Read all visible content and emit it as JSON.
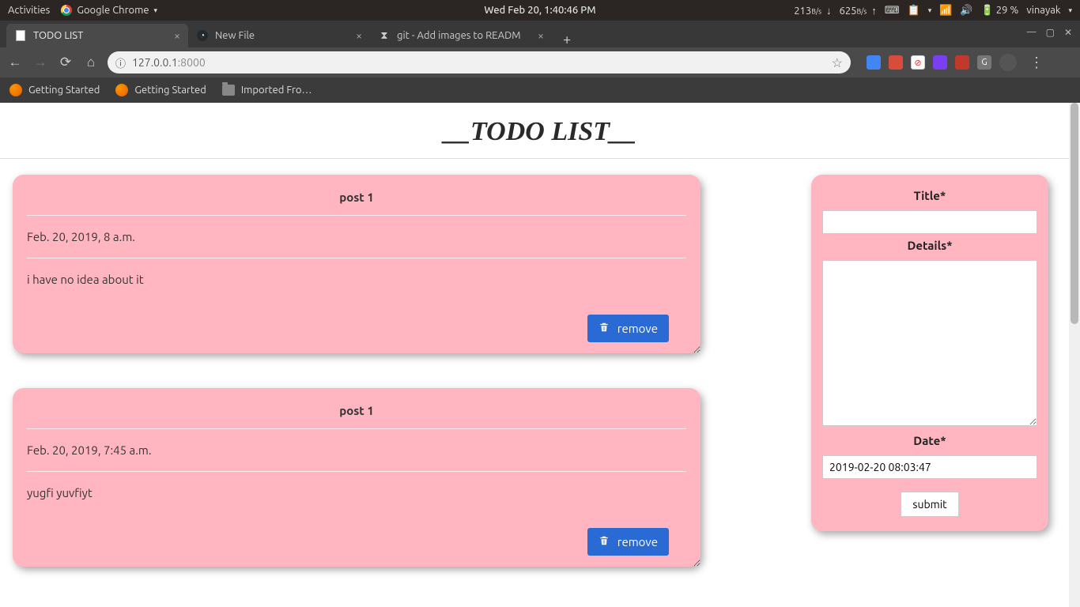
{
  "topbar": {
    "activities": "Activities",
    "appname": "Google Chrome",
    "clock": "Wed Feb 20,  1:40:46 PM",
    "net_down": "213",
    "net_up": "625",
    "net_unit": "B/s",
    "battery": "29 %",
    "user": "vinayak"
  },
  "tabs": [
    {
      "label": "TODO LIST",
      "active": true,
      "favicon": "doc"
    },
    {
      "label": "New File",
      "active": false,
      "favicon": "github"
    },
    {
      "label": "git - Add images to READM",
      "active": false,
      "favicon": "so"
    }
  ],
  "toolbar": {
    "url_host": "127.0.0.1",
    "url_port": ":8000"
  },
  "bookmarks": [
    {
      "label": "Getting Started",
      "icon": "ff"
    },
    {
      "label": "Getting Started",
      "icon": "ff"
    },
    {
      "label": "Imported Fro…",
      "icon": "folder"
    }
  ],
  "page": {
    "title": "__TODO LIST__",
    "remove_label": "remove",
    "posts": [
      {
        "title": "post 1",
        "date": "Feb. 20, 2019, 8 a.m.",
        "body": "i have no idea about it"
      },
      {
        "title": "post 1",
        "date": "Feb. 20, 2019, 7:45 a.m.",
        "body": "yugfi yuvfiyt"
      }
    ],
    "form": {
      "title_label": "Title*",
      "details_label": "Details*",
      "date_label": "Date*",
      "date_value": "2019-02-20 08:03:47",
      "submit": "submit"
    }
  }
}
